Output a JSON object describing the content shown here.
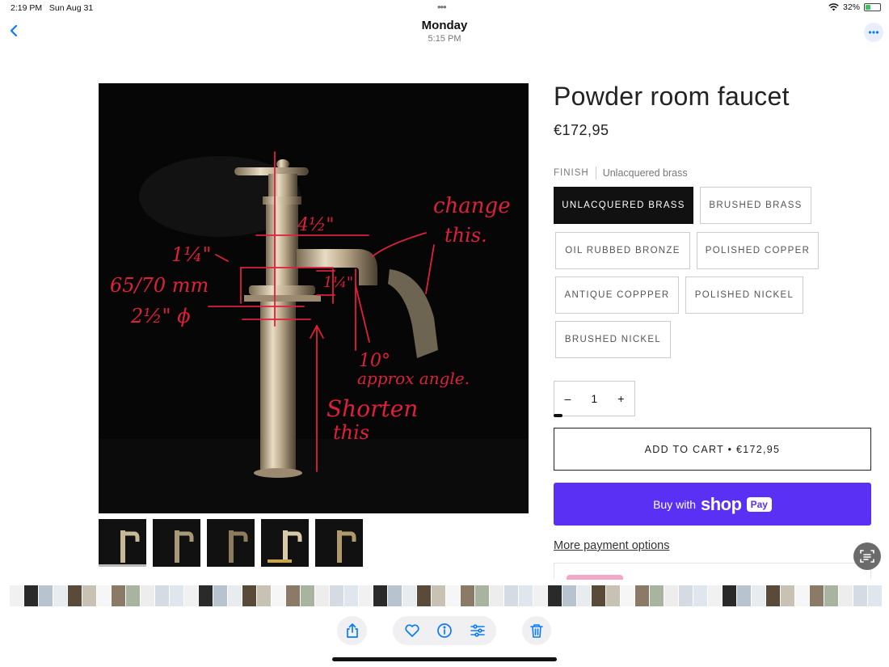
{
  "status": {
    "time": "2:19 PM",
    "date": "Sun Aug 31",
    "battery": "32%"
  },
  "nav": {
    "title": "Monday",
    "subtitle": "5:15 PM"
  },
  "product": {
    "title": "Powder room faucet",
    "price": "€172,95",
    "finish_label": "FINISH",
    "finish_value": "Unlacquered brass",
    "options": [
      {
        "label": "UNLACQUERED BRASS",
        "selected": true
      },
      {
        "label": "BRUSHED BRASS",
        "selected": false
      },
      {
        "label": "OIL RUBBED BRONZE",
        "selected": false
      },
      {
        "label": "POLISHED COPPER",
        "selected": false
      },
      {
        "label": "ANTIQUE COPPPER",
        "selected": false
      },
      {
        "label": "POLISHED NICKEL",
        "selected": false
      },
      {
        "label": "BRUSHED NICKEL",
        "selected": false
      }
    ],
    "qty": {
      "minus": "–",
      "value": "1",
      "plus": "+"
    },
    "add_to_cart": "ADD TO CART • €172,95",
    "shoppay": {
      "buy": "Buy with",
      "shop": "shop",
      "pay": "Pay"
    },
    "more_payment": "More payment options"
  },
  "annotations": {
    "dim_top": "4½\"",
    "dim_left": "1¼\"",
    "dim_right": "1¼\"",
    "base_mm": "65/70 mm",
    "base_in": "2½\" ϕ",
    "change": "change",
    "change2": "this.",
    "angle": "10°",
    "angle2": "approx angle.",
    "shorten": "Shorten",
    "shorten2": "this"
  },
  "colors": {
    "accent": "#0a7aff",
    "shoppay": "#5a31f4",
    "annotation": "#e0203a"
  },
  "icons": [
    "back-chevron-icon",
    "more-icon",
    "share-icon",
    "heart-icon",
    "info-icon",
    "adjust-icon",
    "trash-icon",
    "live-text-icon",
    "wifi-icon",
    "battery-icon"
  ]
}
